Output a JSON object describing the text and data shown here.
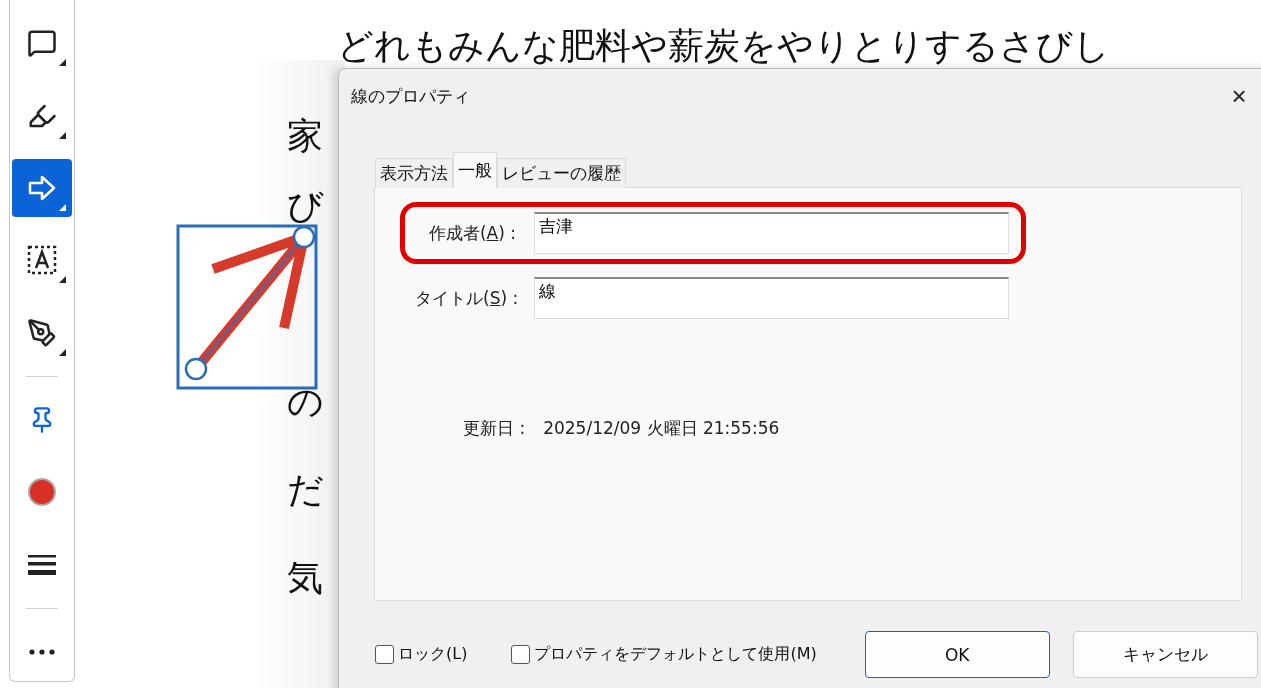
{
  "toolbar": {
    "tools": [
      {
        "kind": "comment",
        "selected": false,
        "has_menu": true
      },
      {
        "kind": "highlight",
        "selected": false,
        "has_menu": true
      },
      {
        "kind": "shape",
        "selected": true,
        "has_menu": true
      },
      {
        "kind": "textbox",
        "selected": false,
        "has_menu": true
      },
      {
        "kind": "sign",
        "selected": false,
        "has_menu": true
      },
      {
        "kind": "divider"
      },
      {
        "kind": "pin",
        "selected": false,
        "has_menu": false
      },
      {
        "kind": "color",
        "selected": false,
        "has_menu": false,
        "color": "#d93025"
      },
      {
        "kind": "line_weight",
        "selected": false,
        "has_menu": false
      },
      {
        "kind": "divider"
      },
      {
        "kind": "more",
        "selected": false,
        "has_menu": false
      }
    ]
  },
  "document": {
    "heading_line": "どれもみんな肥料や薪炭をやりとりするさびし",
    "lines": [
      "家",
      "び",
      "の",
      "だ",
      "気"
    ]
  },
  "dialog": {
    "title": "線のプロパティ",
    "close": "×",
    "tabs": [
      {
        "label": "表示方法",
        "selected": false
      },
      {
        "label": "一般",
        "selected": true
      },
      {
        "label": "レビューの履歴",
        "selected": false
      }
    ],
    "fields": [
      {
        "prefix": "作成者(",
        "accesskey": "A",
        "suffix": ") :",
        "value": "吉津",
        "highlighted": true
      },
      {
        "prefix": "タイトル(",
        "accesskey": "S",
        "suffix": ") :",
        "value": "線",
        "highlighted": false
      }
    ],
    "modified": {
      "label": "更新日 :",
      "value": "2025/12/09 火曜日 21:55:56"
    },
    "checkboxes": [
      {
        "label": "ロック(L)",
        "checked": false
      },
      {
        "label": "プロパティをデフォルトとして使用(M)",
        "checked": false
      }
    ],
    "buttons": [
      {
        "label": "OK",
        "default": true
      },
      {
        "label": "キャンセル",
        "default": false
      }
    ]
  }
}
